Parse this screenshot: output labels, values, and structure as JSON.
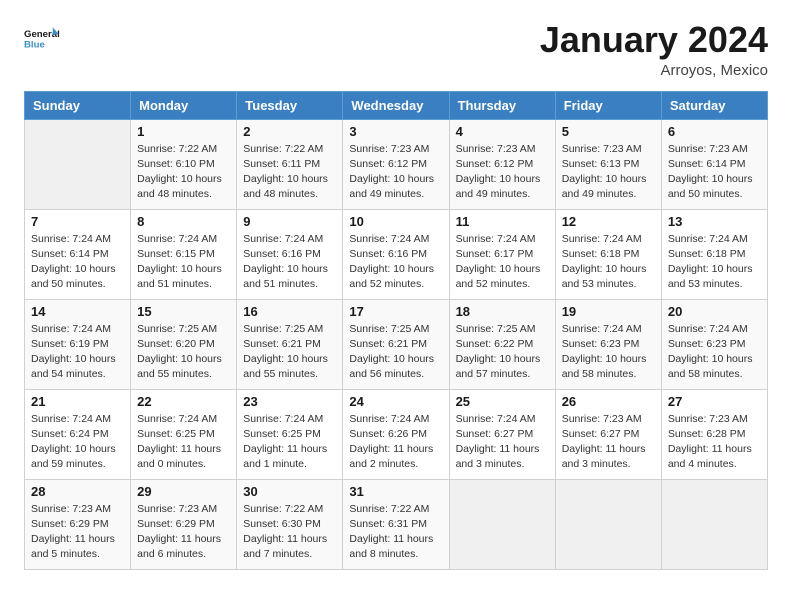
{
  "header": {
    "logo_line1": "General",
    "logo_line2": "Blue",
    "month_title": "January 2024",
    "location": "Arroyos, Mexico"
  },
  "columns": [
    "Sunday",
    "Monday",
    "Tuesday",
    "Wednesday",
    "Thursday",
    "Friday",
    "Saturday"
  ],
  "weeks": [
    [
      {
        "day": "",
        "info": ""
      },
      {
        "day": "1",
        "info": "Sunrise: 7:22 AM\nSunset: 6:10 PM\nDaylight: 10 hours\nand 48 minutes."
      },
      {
        "day": "2",
        "info": "Sunrise: 7:22 AM\nSunset: 6:11 PM\nDaylight: 10 hours\nand 48 minutes."
      },
      {
        "day": "3",
        "info": "Sunrise: 7:23 AM\nSunset: 6:12 PM\nDaylight: 10 hours\nand 49 minutes."
      },
      {
        "day": "4",
        "info": "Sunrise: 7:23 AM\nSunset: 6:12 PM\nDaylight: 10 hours\nand 49 minutes."
      },
      {
        "day": "5",
        "info": "Sunrise: 7:23 AM\nSunset: 6:13 PM\nDaylight: 10 hours\nand 49 minutes."
      },
      {
        "day": "6",
        "info": "Sunrise: 7:23 AM\nSunset: 6:14 PM\nDaylight: 10 hours\nand 50 minutes."
      }
    ],
    [
      {
        "day": "7",
        "info": "Sunrise: 7:24 AM\nSunset: 6:14 PM\nDaylight: 10 hours\nand 50 minutes."
      },
      {
        "day": "8",
        "info": "Sunrise: 7:24 AM\nSunset: 6:15 PM\nDaylight: 10 hours\nand 51 minutes."
      },
      {
        "day": "9",
        "info": "Sunrise: 7:24 AM\nSunset: 6:16 PM\nDaylight: 10 hours\nand 51 minutes."
      },
      {
        "day": "10",
        "info": "Sunrise: 7:24 AM\nSunset: 6:16 PM\nDaylight: 10 hours\nand 52 minutes."
      },
      {
        "day": "11",
        "info": "Sunrise: 7:24 AM\nSunset: 6:17 PM\nDaylight: 10 hours\nand 52 minutes."
      },
      {
        "day": "12",
        "info": "Sunrise: 7:24 AM\nSunset: 6:18 PM\nDaylight: 10 hours\nand 53 minutes."
      },
      {
        "day": "13",
        "info": "Sunrise: 7:24 AM\nSunset: 6:18 PM\nDaylight: 10 hours\nand 53 minutes."
      }
    ],
    [
      {
        "day": "14",
        "info": "Sunrise: 7:24 AM\nSunset: 6:19 PM\nDaylight: 10 hours\nand 54 minutes."
      },
      {
        "day": "15",
        "info": "Sunrise: 7:25 AM\nSunset: 6:20 PM\nDaylight: 10 hours\nand 55 minutes."
      },
      {
        "day": "16",
        "info": "Sunrise: 7:25 AM\nSunset: 6:21 PM\nDaylight: 10 hours\nand 55 minutes."
      },
      {
        "day": "17",
        "info": "Sunrise: 7:25 AM\nSunset: 6:21 PM\nDaylight: 10 hours\nand 56 minutes."
      },
      {
        "day": "18",
        "info": "Sunrise: 7:25 AM\nSunset: 6:22 PM\nDaylight: 10 hours\nand 57 minutes."
      },
      {
        "day": "19",
        "info": "Sunrise: 7:24 AM\nSunset: 6:23 PM\nDaylight: 10 hours\nand 58 minutes."
      },
      {
        "day": "20",
        "info": "Sunrise: 7:24 AM\nSunset: 6:23 PM\nDaylight: 10 hours\nand 58 minutes."
      }
    ],
    [
      {
        "day": "21",
        "info": "Sunrise: 7:24 AM\nSunset: 6:24 PM\nDaylight: 10 hours\nand 59 minutes."
      },
      {
        "day": "22",
        "info": "Sunrise: 7:24 AM\nSunset: 6:25 PM\nDaylight: 11 hours\nand 0 minutes."
      },
      {
        "day": "23",
        "info": "Sunrise: 7:24 AM\nSunset: 6:25 PM\nDaylight: 11 hours\nand 1 minute."
      },
      {
        "day": "24",
        "info": "Sunrise: 7:24 AM\nSunset: 6:26 PM\nDaylight: 11 hours\nand 2 minutes."
      },
      {
        "day": "25",
        "info": "Sunrise: 7:24 AM\nSunset: 6:27 PM\nDaylight: 11 hours\nand 3 minutes."
      },
      {
        "day": "26",
        "info": "Sunrise: 7:23 AM\nSunset: 6:27 PM\nDaylight: 11 hours\nand 3 minutes."
      },
      {
        "day": "27",
        "info": "Sunrise: 7:23 AM\nSunset: 6:28 PM\nDaylight: 11 hours\nand 4 minutes."
      }
    ],
    [
      {
        "day": "28",
        "info": "Sunrise: 7:23 AM\nSunset: 6:29 PM\nDaylight: 11 hours\nand 5 minutes."
      },
      {
        "day": "29",
        "info": "Sunrise: 7:23 AM\nSunset: 6:29 PM\nDaylight: 11 hours\nand 6 minutes."
      },
      {
        "day": "30",
        "info": "Sunrise: 7:22 AM\nSunset: 6:30 PM\nDaylight: 11 hours\nand 7 minutes."
      },
      {
        "day": "31",
        "info": "Sunrise: 7:22 AM\nSunset: 6:31 PM\nDaylight: 11 hours\nand 8 minutes."
      },
      {
        "day": "",
        "info": ""
      },
      {
        "day": "",
        "info": ""
      },
      {
        "day": "",
        "info": ""
      }
    ]
  ]
}
